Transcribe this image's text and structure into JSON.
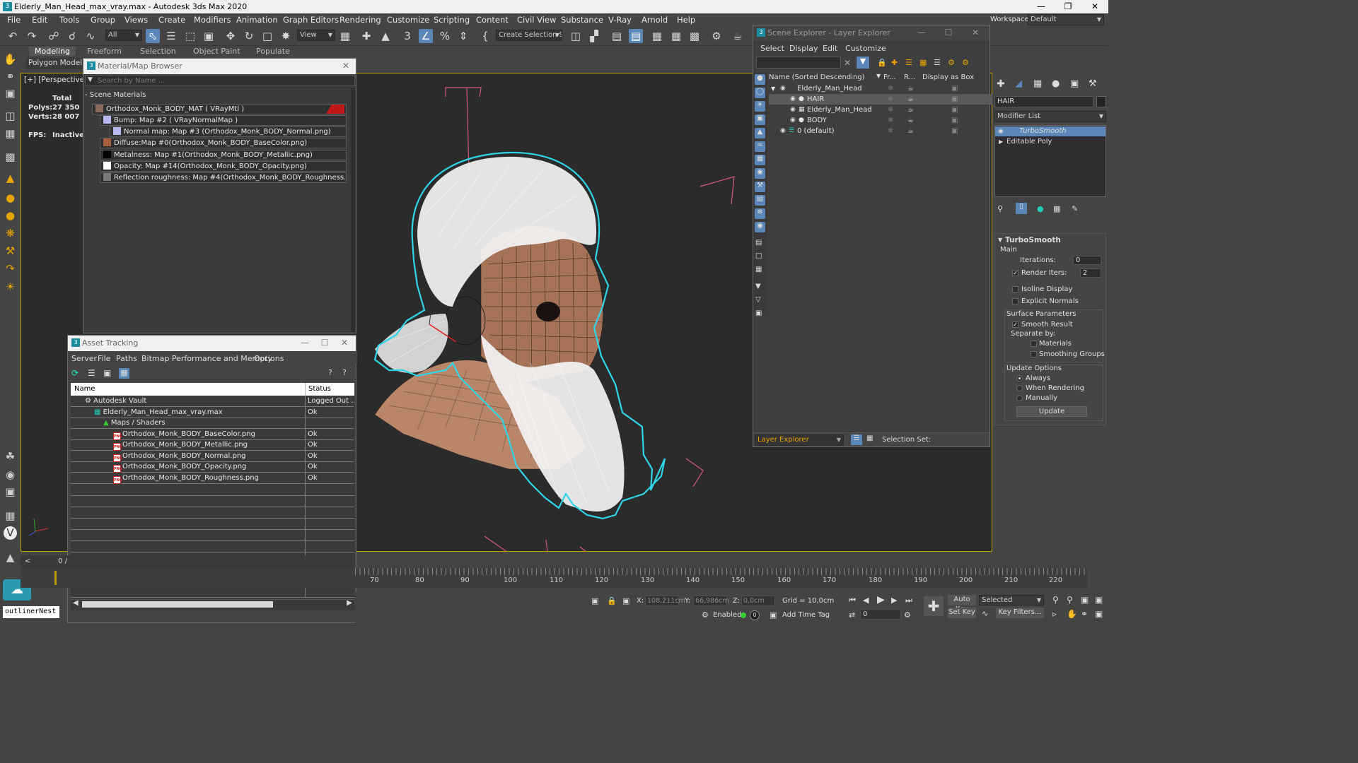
{
  "window": {
    "title": "Elderly_Man_Head_max_vray.max - Autodesk 3ds Max 2020",
    "workspaces_label": "Workspaces:",
    "workspace_value": "Default"
  },
  "menu": [
    "File",
    "Edit",
    "Tools",
    "Group",
    "Views",
    "Create",
    "Modifiers",
    "Animation",
    "Graph Editors",
    "Rendering",
    "Customize",
    "Scripting",
    "Content",
    "Civil View",
    "Substance",
    "V-Ray",
    "Arnold",
    "Help"
  ],
  "toolbar": {
    "selection_filter": "All",
    "ref_coord": "View",
    "named_selection": "Create Selection Se"
  },
  "ribbon": {
    "tabs": [
      "Modeling",
      "Freeform",
      "Selection",
      "Object Paint",
      "Populate"
    ],
    "sublabel": "Polygon Modelin"
  },
  "viewport": {
    "label": "[+] [Perspective] [S",
    "stats": {
      "total_label": "Total",
      "polys_label": "Polys:",
      "polys_value": "27 350",
      "verts_label": "Verts:",
      "verts_value": "28 007",
      "fps_label": "FPS:",
      "fps_value": "Inactive"
    }
  },
  "material_browser": {
    "title": "Material/Map Browser",
    "search_placeholder": "Search by Name ...",
    "section": "Scene Materials",
    "rows": [
      "Orthodox_Monk_BODY_MAT  ( VRayMtl )",
      "Bump: Map #2  ( VRayNormalMap )",
      "Normal map: Map #3 (Orthodox_Monk_BODY_Normal.png)",
      "Diffuse:Map #0(Orthodox_Monk_BODY_BaseColor.png)",
      "Metalness: Map #1(Orthodox_Monk_BODY_Metallic.png)",
      "Opacity: Map #14(Orthodox_Monk_BODY_Opacity.png)",
      "Reflection roughness: Map #4(Orthodox_Monk_BODY_Roughness.png)"
    ]
  },
  "asset_tracking": {
    "title": "Asset Tracking",
    "menu": [
      "Server",
      "File",
      "Paths",
      "Bitmap Performance and Memory",
      "Options"
    ],
    "col_name": "Name",
    "col_status": "Status",
    "rows": [
      {
        "name": "Autodesk Vault",
        "status": "Logged Out ..."
      },
      {
        "name": "Elderly_Man_Head_max_vray.max",
        "status": "Ok"
      },
      {
        "name": "Maps / Shaders",
        "status": ""
      },
      {
        "name": "Orthodox_Monk_BODY_BaseColor.png",
        "status": "Ok"
      },
      {
        "name": "Orthodox_Monk_BODY_Metallic.png",
        "status": "Ok"
      },
      {
        "name": "Orthodox_Monk_BODY_Normal.png",
        "status": "Ok"
      },
      {
        "name": "Orthodox_Monk_BODY_Opacity.png",
        "status": "Ok"
      },
      {
        "name": "Orthodox_Monk_BODY_Roughness.png",
        "status": "Ok"
      }
    ]
  },
  "scene_explorer": {
    "title": "Scene Explorer - Layer Explorer",
    "menu": [
      "Select",
      "Display",
      "Edit",
      "Customize"
    ],
    "col_name": "Name (Sorted Descending)",
    "col_freeze": "Fr...",
    "col_render": "R...",
    "col_box": "Display as Box",
    "rows": [
      {
        "name": "Elderly_Man_Head"
      },
      {
        "name": "HAIR"
      },
      {
        "name": "Elderly_Man_Head"
      },
      {
        "name": "BODY"
      },
      {
        "name": "0 (default)"
      }
    ],
    "footer_dropdown": "Layer Explorer",
    "selection_set_label": "Selection Set:"
  },
  "command_panel": {
    "object_name": "HAIR",
    "modifier_list": "Modifier List",
    "stack": [
      "TurboSmooth",
      "Editable Poly"
    ],
    "rollout_title": "TurboSmooth",
    "main_label": "Main",
    "iterations_label": "Iterations:",
    "iterations_value": "0",
    "render_iters_label": "Render Iters:",
    "render_iters_value": "2",
    "isoline_label": "Isoline Display",
    "explicit_label": "Explicit Normals",
    "surface_label": "Surface Parameters",
    "smooth_label": "Smooth Result",
    "separate_label": "Separate by:",
    "materials_label": "Materials",
    "smoothing_label": "Smoothing Groups",
    "update_options_label": "Update Options",
    "always_label": "Always",
    "when_rendering_label": "When Rendering",
    "manually_label": "Manually",
    "update_button": "Update"
  },
  "timeline": {
    "frame_counter": "0 /",
    "ticks": [
      "70",
      "80",
      "90",
      "100",
      "110",
      "120",
      "130",
      "140",
      "150",
      "160",
      "170",
      "180",
      "190",
      "200",
      "210",
      "220"
    ]
  },
  "status": {
    "x_label": "X:",
    "x_value": "108,211cm",
    "y_label": "Y:",
    "y_value": "66,986cm",
    "z_label": "Z:",
    "z_value": "0,0cm",
    "grid": "Grid = 10,0cm",
    "enabled_label": "Enabled:",
    "add_time_tag": "Add Time Tag",
    "auto_key": "Auto Key",
    "set_key": "Set Key",
    "selected_value": "Selected",
    "key_filters": "Key Filters...",
    "frame_value": "0",
    "script_listener": "outlinerNest"
  },
  "colors": {
    "accent": "#5a86b8",
    "viewport_border": "#c4a200",
    "selection_cyan": "#2fd6e8",
    "skin": "#b9866a"
  }
}
